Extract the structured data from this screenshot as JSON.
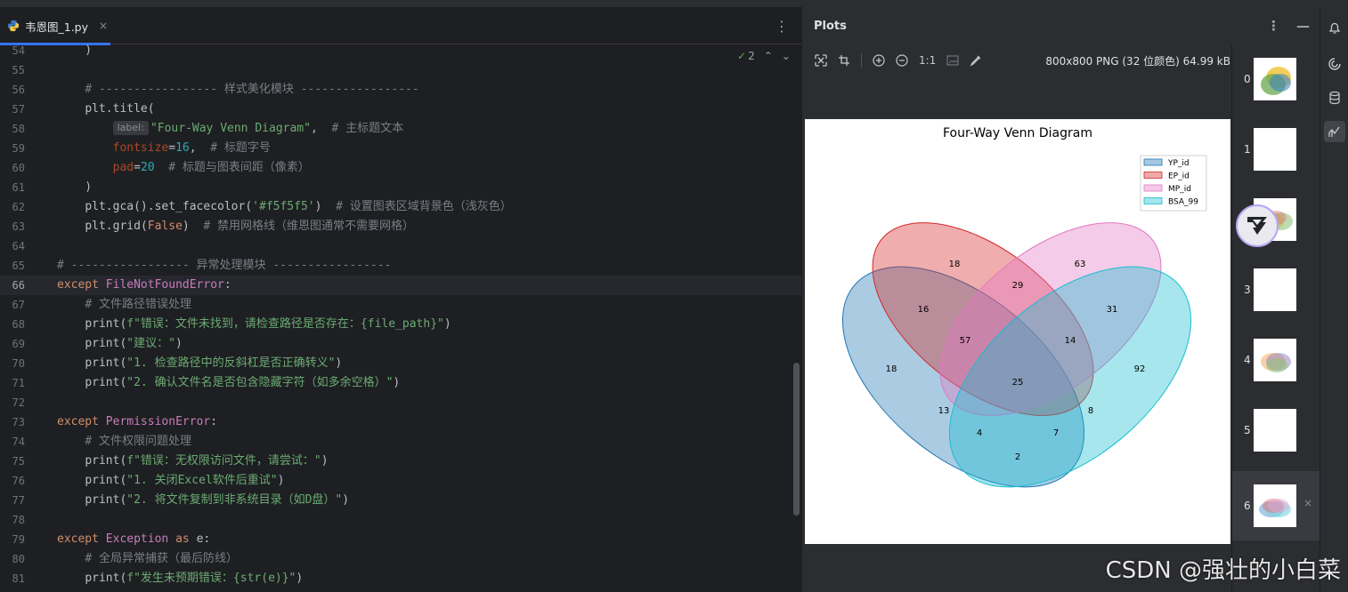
{
  "editor": {
    "tab_name": "韦恩图_1.py",
    "tab_close": "×",
    "menu_glyph": "⋮",
    "inspection_count": "2",
    "inspection_glyphs": {
      "ok": "✓",
      "up": "⌃",
      "down": "⌄"
    }
  },
  "code_lines": [
    {
      "n": "54",
      "src": "    )"
    },
    {
      "n": "55",
      "src": ""
    },
    {
      "n": "56",
      "src": "    # ----------------- 样式美化模块 -----------------"
    },
    {
      "n": "57",
      "src": "    plt.title("
    },
    {
      "n": "58",
      "hint": "label:",
      "src": "        \"Four-Way Venn Diagram\",  # 主标题文本"
    },
    {
      "n": "59",
      "src": "        fontsize=16,  # 标题字号"
    },
    {
      "n": "60",
      "src": "        pad=20  # 标题与图表间距（像素）"
    },
    {
      "n": "61",
      "src": "    )"
    },
    {
      "n": "62",
      "src": "    plt.gca().set_facecolor('#f5f5f5')  # 设置图表区域背景色（浅灰色）"
    },
    {
      "n": "63",
      "src": "    plt.grid(False)  # 禁用网格线（维恩图通常不需要网格）"
    },
    {
      "n": "64",
      "src": ""
    },
    {
      "n": "65",
      "src": "# ----------------- 异常处理模块 -----------------"
    },
    {
      "n": "66",
      "src": "except FileNotFoundError:"
    },
    {
      "n": "67",
      "src": "    # 文件路径错误处理"
    },
    {
      "n": "68",
      "src": "    print(f\"错误：文件未找到，请检查路径是否存在：{file_path}\")"
    },
    {
      "n": "69",
      "src": "    print(\"建议：\")"
    },
    {
      "n": "70",
      "src": "    print(\"1. 检查路径中的反斜杠是否正确转义\")"
    },
    {
      "n": "71",
      "src": "    print(\"2. 确认文件名是否包含隐藏字符（如多余空格）\")"
    },
    {
      "n": "72",
      "src": ""
    },
    {
      "n": "73",
      "src": "except PermissionError:"
    },
    {
      "n": "74",
      "src": "    # 文件权限问题处理"
    },
    {
      "n": "75",
      "src": "    print(f\"错误：无权限访问文件，请尝试：\")"
    },
    {
      "n": "76",
      "src": "    print(\"1. 关闭Excel软件后重试\")"
    },
    {
      "n": "77",
      "src": "    print(\"2. 将文件复制到非系统目录（如D盘）\")"
    },
    {
      "n": "78",
      "src": ""
    },
    {
      "n": "79",
      "src": "except Exception as e:"
    },
    {
      "n": "80",
      "src": "    # 全局异常捕获（最后防线）"
    },
    {
      "n": "81",
      "src": "    print(f\"发生未预期错误：{str(e)}\")"
    }
  ],
  "current_line": "66",
  "plots": {
    "title": "Plots",
    "menu_glyph": "⋮",
    "minimize_glyph": "—",
    "toolbar": {
      "fit_glyph": "⌗",
      "zoom_in": "⊕",
      "zoom_out": "⊖",
      "actual_size": "1:1",
      "edit_glyph": "✎"
    },
    "image_info": "800x800 PNG (32 位颜色) 64.99 kB",
    "thumbnails": [
      "0",
      "1",
      "2",
      "3",
      "4",
      "5",
      "6"
    ],
    "selected_thumbnail": "6",
    "thumb_close": "×"
  },
  "chart_data": {
    "type": "venn",
    "title": "Four-Way Venn Diagram",
    "legend_position": "upper-right",
    "sets": [
      {
        "name": "YP_id",
        "color": "#1f77b4"
      },
      {
        "name": "EP_id",
        "color": "#d62728"
      },
      {
        "name": "MP_id",
        "color": "#e377c2"
      },
      {
        "name": "BSA_99",
        "color": "#17becf"
      }
    ],
    "regions": [
      {
        "sets": [
          "EP_id"
        ],
        "value": "18"
      },
      {
        "sets": [
          "MP_id"
        ],
        "value": "63"
      },
      {
        "sets": [
          "EP_id",
          "MP_id"
        ],
        "value": "29"
      },
      {
        "sets": [
          "YP_id",
          "EP_id"
        ],
        "value": "16"
      },
      {
        "sets": [
          "MP_id",
          "BSA_99"
        ],
        "value": "31"
      },
      {
        "sets": [
          "YP_id",
          "EP_id",
          "MP_id"
        ],
        "value": "57"
      },
      {
        "sets": [
          "EP_id",
          "MP_id",
          "BSA_99"
        ],
        "value": "14"
      },
      {
        "sets": [
          "YP_id"
        ],
        "value": "18"
      },
      {
        "sets": [
          "BSA_99"
        ],
        "value": "92"
      },
      {
        "sets": [
          "YP_id",
          "EP_id",
          "MP_id",
          "BSA_99"
        ],
        "value": "25"
      },
      {
        "sets": [
          "YP_id",
          "MP_id"
        ],
        "value": "13"
      },
      {
        "sets": [
          "EP_id",
          "BSA_99"
        ],
        "value": "8"
      },
      {
        "sets": [
          "YP_id",
          "MP_id",
          "BSA_99"
        ],
        "value": "4"
      },
      {
        "sets": [
          "YP_id",
          "EP_id",
          "BSA_99"
        ],
        "value": "7"
      },
      {
        "sets": [
          "YP_id",
          "BSA_99"
        ],
        "value": "2"
      }
    ]
  },
  "watermark": "CSDN @强壮的小白菜"
}
